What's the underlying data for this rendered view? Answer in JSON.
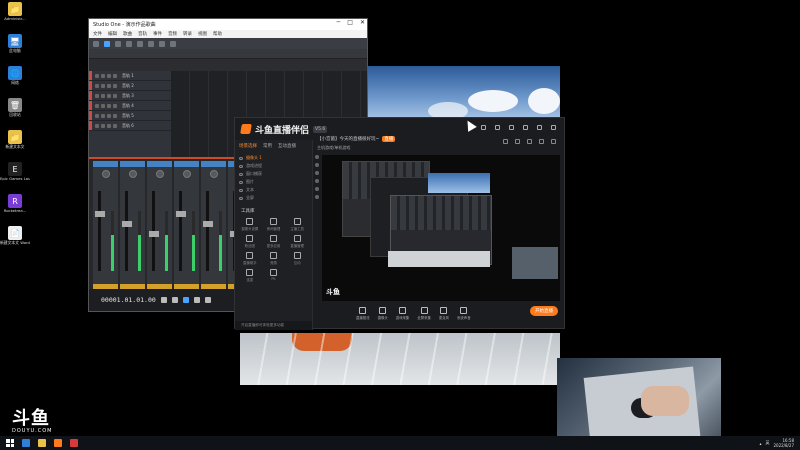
{
  "desktop": {
    "icons": [
      {
        "label": "Administr...",
        "color": "#e8c24a",
        "glyph": "📁"
      },
      {
        "label": "此电脑",
        "color": "#2f7ed8",
        "glyph": "🖥"
      },
      {
        "label": "网络",
        "color": "#2f7ed8",
        "glyph": "🌐"
      },
      {
        "label": "回收站",
        "color": "#888888",
        "glyph": "🗑"
      },
      {
        "label": "新建文本文",
        "color": "#e8c24a",
        "glyph": "📁"
      },
      {
        "label": "Epic Games Launcher",
        "color": "#222222",
        "glyph": "E"
      },
      {
        "label": "Rocketrea...",
        "color": "#7a3cd6",
        "glyph": "R"
      },
      {
        "label": "新建文本文 Word",
        "color": "#eeeeee",
        "glyph": "📄"
      }
    ]
  },
  "daw": {
    "title": "Studio One - 演示作品歌曲",
    "menu": [
      "文件",
      "编辑",
      "歌曲",
      "音轨",
      "事件",
      "音频",
      "转录",
      "视图",
      "帮助"
    ],
    "tracks": [
      "音轨 1",
      "音轨 2",
      "音轨 3",
      "音轨 4",
      "音轨 5",
      "音轨 6"
    ],
    "strips": 7,
    "timecode": "00001.01.01.00"
  },
  "douyu": {
    "app_name": "斗鱼直播伴侣",
    "version": "V5.6",
    "tabs": [
      "场景选择",
      "常用",
      "互动直播"
    ],
    "sources": [
      "摄像头 1",
      "游戏进程",
      "窗口捕获",
      "图片",
      "文本",
      "全屏"
    ],
    "tools_title": "工具库",
    "tools": [
      "摄像头设置",
      "房间管理",
      "主播工具",
      "粉丝团",
      "更多应用",
      "直播管理",
      "直播助手",
      "竞猜",
      "互动",
      "连麦",
      "PK"
    ],
    "footer": "开启直播即可体验更多功能",
    "room_title": "【小宫菌】今天的直播很好玩~",
    "room_tag": "直播",
    "category": "主机游戏/单机游戏",
    "controls": [
      "直播推流",
      "摄像头",
      "游戏采集",
      "全屏采集",
      "麦克风",
      "系统声音"
    ],
    "start_live": "开始直播"
  },
  "watermark": {
    "big": "斗鱼",
    "small": "DOUYU.COM"
  },
  "taskbar": {
    "time": "16:58",
    "date": "2022/8/27",
    "lang": "英",
    "apps": [
      {
        "color": "#2f7ed8"
      },
      {
        "color": "#e8c24a"
      },
      {
        "color": "#ff7a1a"
      },
      {
        "color": "#d83a3a"
      }
    ]
  }
}
